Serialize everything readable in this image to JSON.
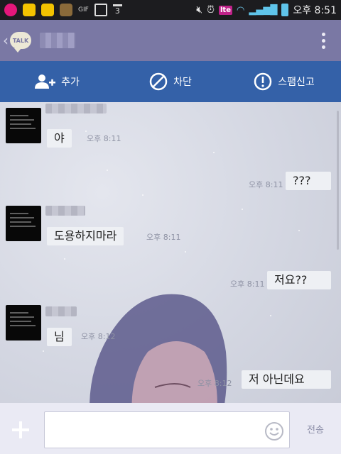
{
  "status_bar": {
    "time": "오후 8:51",
    "network": "lte",
    "icons": [
      "u-plus-icon",
      "yellow-app-icon",
      "yellow-app-icon-2",
      "sticker-app-icon",
      "gif-icon",
      "image-icon",
      "calendar-icon",
      "mute-icon",
      "alarm-icon",
      "lte-icon",
      "wifi-icon",
      "signal-icon",
      "battery-icon"
    ],
    "calendar_day": "3",
    "gif_label": "GIF"
  },
  "header": {
    "logo_label": "TALK",
    "chat_name": ""
  },
  "actions": [
    {
      "label": "추가",
      "icon": "add-friend-icon"
    },
    {
      "label": "차단",
      "icon": "block-icon"
    },
    {
      "label": "스팸신고",
      "icon": "report-icon"
    }
  ],
  "messages": [
    {
      "side": "left",
      "text": "야",
      "time": "오후 8:11"
    },
    {
      "side": "right",
      "text": "???",
      "time": "오후 8:11"
    },
    {
      "side": "left",
      "text": "도용하지마라",
      "time": "오후 8:11"
    },
    {
      "side": "right",
      "text": "저요??",
      "time": "오후 8:11"
    },
    {
      "side": "left",
      "text": "님",
      "time": "오후 8:12"
    },
    {
      "side": "right",
      "text": "저 아닌데요",
      "time": "오후 8:12"
    }
  ],
  "input": {
    "placeholder": "",
    "send_label": "전송"
  },
  "colors": {
    "header": "#7a78a4",
    "action_bar": "#3461a8",
    "bubble": "#eef0f4",
    "input_bar": "#eaeaf4"
  }
}
